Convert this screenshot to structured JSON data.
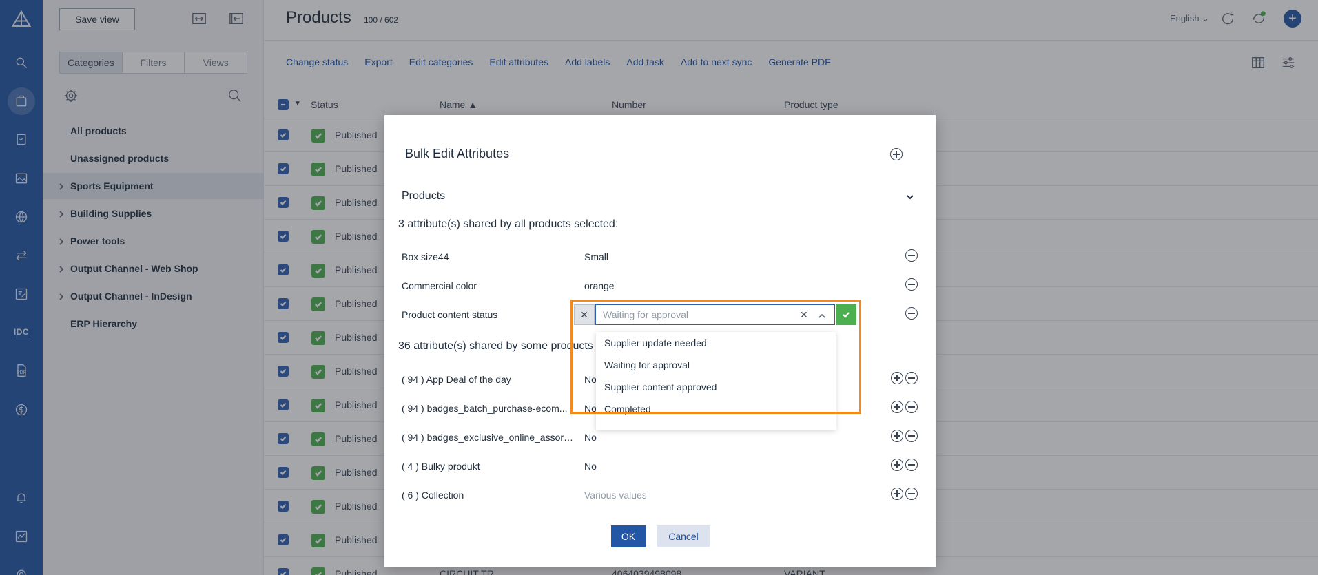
{
  "rail": {
    "icons": [
      "logo-icon",
      "search-icon",
      "products-icon",
      "tasks-icon",
      "media-icon",
      "globe-icon",
      "sync-icon",
      "edit-icon",
      "idc-icon",
      "pdf-icon",
      "dollar-icon",
      "bell-icon",
      "analytics-icon",
      "settings-icon"
    ],
    "idc_label": "IDC",
    "pdf_label": "PDF"
  },
  "side": {
    "save_view": "Save view",
    "tabs": [
      "Categories",
      "Filters",
      "Views"
    ],
    "active_tab": "Categories",
    "categories": [
      {
        "label": "All products",
        "expandable": false,
        "selected": false
      },
      {
        "label": "Unassigned products",
        "expandable": false,
        "selected": false
      },
      {
        "label": "Sports Equipment",
        "expandable": true,
        "selected": true
      },
      {
        "label": "Building Supplies",
        "expandable": true,
        "selected": false
      },
      {
        "label": "Power tools",
        "expandable": true,
        "selected": false
      },
      {
        "label": "Output Channel - Web Shop",
        "expandable": true,
        "selected": false
      },
      {
        "label": "Output Channel - InDesign",
        "expandable": true,
        "selected": false
      },
      {
        "label": "ERP Hierarchy",
        "expandable": false,
        "selected": false
      }
    ]
  },
  "header": {
    "title": "Products",
    "count": "100 / 602",
    "language": "English"
  },
  "actions": [
    "Change status",
    "Export",
    "Edit categories",
    "Edit attributes",
    "Add labels",
    "Add task",
    "Add to next sync",
    "Generate PDF"
  ],
  "table": {
    "columns": {
      "status": "Status",
      "name": "Name ▲",
      "number": "Number",
      "type": "Product type"
    },
    "status_text": "Published",
    "last_row": {
      "name": "CIRCUIT TR",
      "number": "4064039498098",
      "type": "VARIANT"
    }
  },
  "modal": {
    "title": "Bulk Edit Attributes",
    "section": "Products",
    "shared_all": "3 attribute(s) shared by all products selected:",
    "shared_some": "36 attribute(s) shared by some products",
    "all_attrs": [
      {
        "label": "Box size44",
        "value": "Small"
      },
      {
        "label": "Commercial color",
        "value": "orange"
      },
      {
        "label": "Product content status",
        "value": ""
      }
    ],
    "some_attrs": [
      {
        "label": "( 94 ) App Deal of the day",
        "value": "No"
      },
      {
        "label": "( 94 ) badges_batch_purchase-ecom...",
        "value": "No"
      },
      {
        "label": "( 94 ) badges_exclusive_online_assort...",
        "value": "No"
      },
      {
        "label": "( 4 ) Bulky produkt",
        "value": "No"
      },
      {
        "label": "( 6 ) Collection",
        "value": "Various values"
      }
    ],
    "select": {
      "placeholder": "Waiting for approval",
      "clear": "✕",
      "cancel": "✕",
      "options": [
        "Supplier update needed",
        "Waiting for approval",
        "Supplier content approved",
        "Completed"
      ]
    },
    "ok": "OK",
    "cancel": "Cancel"
  },
  "colors": {
    "rail": "#2456a6",
    "accent": "#2d5fb0",
    "highlight": "#f08a1e",
    "success": "#4cb050"
  }
}
